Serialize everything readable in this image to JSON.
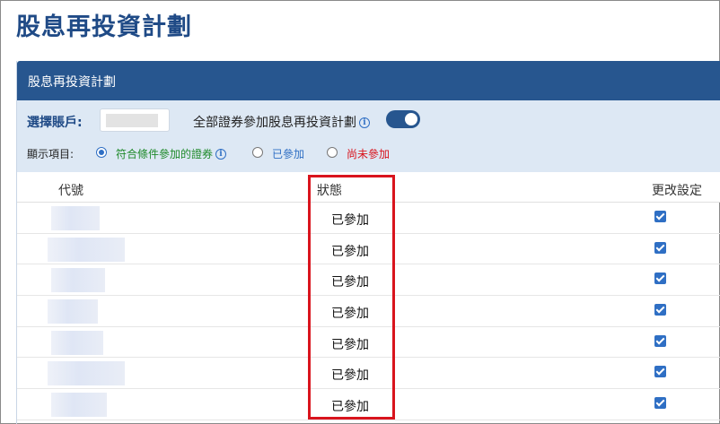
{
  "page": {
    "title": "股息再投資計劃"
  },
  "panel": {
    "header": "股息再投資計劃",
    "account_label": "選擇賬戶:",
    "account_value": "",
    "all_securities_label": "全部證券參加股息再投資計劃",
    "info_icon": "ⓘ",
    "toggle_on": true,
    "display_label": "顯示項目:",
    "options": [
      {
        "label": "符合條件參加的證券",
        "checked": true,
        "color": "#1f8a2a"
      },
      {
        "label": "已參加",
        "checked": false,
        "color": "#2f6fc4"
      },
      {
        "label": "尚未參加",
        "checked": false,
        "color": "#d9141d"
      }
    ]
  },
  "table": {
    "columns": [
      "代號",
      "狀態",
      "更改設定"
    ],
    "rows": [
      {
        "status": "已參加",
        "checked": true
      },
      {
        "status": "已參加",
        "checked": true
      },
      {
        "status": "已參加",
        "checked": true
      },
      {
        "status": "已參加",
        "checked": true
      },
      {
        "status": "已參加",
        "checked": true
      },
      {
        "status": "已參加",
        "checked": true
      },
      {
        "status": "已參加",
        "checked": true
      }
    ]
  },
  "colors": {
    "brand": "#27568f",
    "title": "#1f4a86",
    "highlight": "#d9141d"
  }
}
